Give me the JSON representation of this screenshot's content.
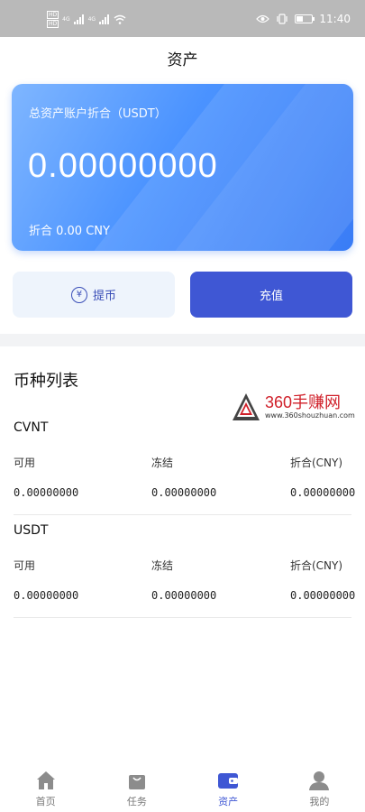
{
  "status_bar": {
    "sim1": "HD",
    "sim2": "HD",
    "net1": "4G",
    "net2": "4G",
    "time": "11:40"
  },
  "header": {
    "title": "资产"
  },
  "asset_card": {
    "label": "总资产账户折合（USDT）",
    "amount": "0.00000000",
    "cny": "折合 0.00 CNY"
  },
  "actions": {
    "withdraw_label": "提币",
    "recharge_label": "充值"
  },
  "section": {
    "title": "币种列表"
  },
  "watermark": {
    "brand": "360手赚网",
    "url": "www.360shouzhuan.com"
  },
  "coins": [
    {
      "name": "CVNT",
      "available_label": "可用",
      "frozen_label": "冻结",
      "cny_label": "折合(CNY)",
      "available": "0.00000000",
      "frozen": "0.00000000",
      "cny": "0.00000000"
    },
    {
      "name": "USDT",
      "available_label": "可用",
      "frozen_label": "冻结",
      "cny_label": "折合(CNY)",
      "available": "0.00000000",
      "frozen": "0.00000000",
      "cny": "0.00000000"
    }
  ],
  "tabbar": {
    "items": [
      {
        "label": "首页",
        "icon": "home-icon",
        "active": false
      },
      {
        "label": "任务",
        "icon": "bag-icon",
        "active": false
      },
      {
        "label": "资产",
        "icon": "wallet-icon",
        "active": true
      },
      {
        "label": "我的",
        "icon": "user-icon",
        "active": false
      }
    ],
    "active_color": "#3f57d4",
    "inactive_color": "#777777"
  }
}
